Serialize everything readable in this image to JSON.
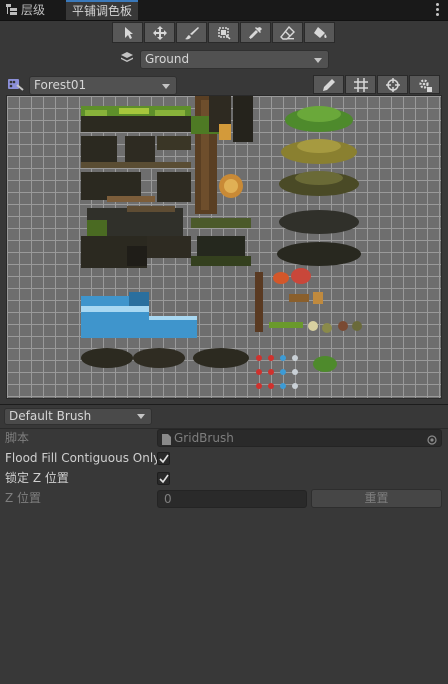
{
  "tabs": [
    {
      "label": "层级"
    },
    {
      "label": "平铺调色板"
    }
  ],
  "toolbar": {
    "tools": [
      "select-tool",
      "move-tool",
      "paint-tool",
      "box-fill-tool",
      "picker-tool",
      "erase-tool",
      "fill-tool"
    ]
  },
  "target_layer": {
    "value": "Ground"
  },
  "palette": {
    "value": "Forest01"
  },
  "palette_tools": [
    "edit-pencil",
    "grid-toggle",
    "gizmo-toggle",
    "settings"
  ],
  "brush": {
    "value": "Default Brush"
  },
  "properties": {
    "script_label": "脚本",
    "script_value": "GridBrush",
    "flood_label": "Flood Fill Contiguous Only",
    "lock_z_label": "锁定 Z 位置",
    "z_label": "Z 位置",
    "z_value": "0",
    "reset_label": "重置"
  },
  "colors": {
    "accent": "#3a79bb",
    "bg": "#383838",
    "grass": "#5e8f2a",
    "water": "#3f95cc"
  }
}
